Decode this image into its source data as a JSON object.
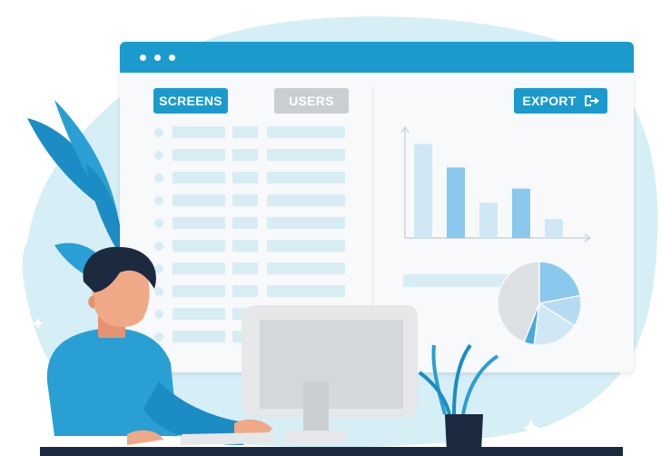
{
  "toolbar": {
    "screens_label": "SCREENS",
    "users_label": "USERS",
    "export_label": "EXPORT"
  },
  "icons": {
    "export": "export-icon",
    "window_dots": "dots-icon"
  },
  "colors": {
    "accent": "#1b9bcd",
    "muted": "#c9ced2",
    "background_blob": "#d6eef6",
    "placeholder": "#d8ecf4",
    "bar": "#8ac8ee",
    "bar_light": "#d0e8f5",
    "shirt": "#2a9fd3",
    "hair": "#1b2a3f",
    "skin": "#f0a987"
  },
  "chart_data": {
    "type": "bar",
    "values": [
      8,
      6,
      3,
      4.2,
      1.6
    ],
    "ylim": [
      0,
      8.5
    ],
    "highlighted": [
      1,
      3
    ]
  },
  "pie_data": {
    "type": "pie",
    "values": [
      22,
      12,
      18,
      4,
      44
    ]
  }
}
